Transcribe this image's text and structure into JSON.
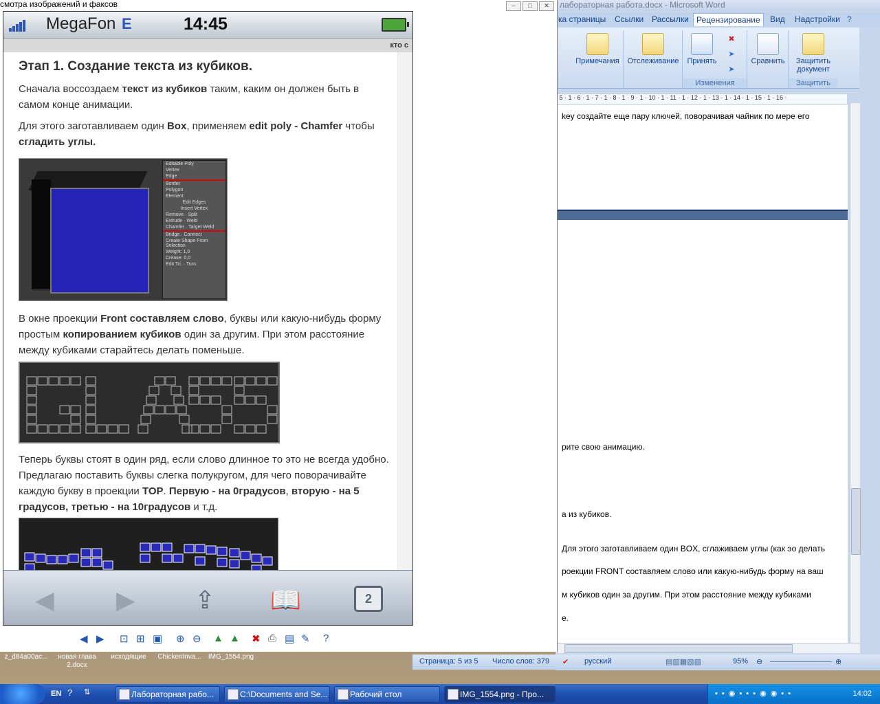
{
  "viewer": {
    "title": "смотра изображений и факсов",
    "phone": {
      "carrier": "MegaFon",
      "network": "E",
      "time": "14:45",
      "site_label": "кто с",
      "article": {
        "heading": "Этап 1. Создание текста из кубиков.",
        "p1_a": "Сначала воссоздаем ",
        "p1_b": "текст из кубиков",
        "p1_c": " таким, каким он должен быть в самом конце анимации.",
        "p2_a": "Для этого заготавливаем один ",
        "p2_b": "Box",
        "p2_c": ", применяем ",
        "p2_d": "edit poly - Chamfer",
        "p2_e": " чтобы ",
        "p2_f": "сгладить углы.",
        "p3_a": "В окне проекции ",
        "p3_b": "Front составляем слово",
        "p3_c": ", буквы или какую-нибудь форму простым ",
        "p3_d": "копированием кубиков",
        "p3_e": " один за другим. При этом расстояние между кубиками старайтесь делать поменьше.",
        "p4_a": "Теперь буквы стоят в один ряд, если слово длинное то это не всегда удобно. Предлагаю поставить буквы слегка полукругом, для чего поворачивайте каждую букву в проекции ",
        "p4_b": "TOP",
        "p4_c": ". ",
        "p4_d": "Первую - на 0градусов",
        "p4_e": ", ",
        "p4_f": "вторую - на 5 градусов, третью - на 10градусов",
        "p4_g": " и т.д."
      },
      "panel_items": [
        "Editable Poly",
        "Vertex",
        "Edge",
        "Border",
        "Polygon",
        "Element",
        "Edit Edges",
        "Insert Vertex",
        "Remove",
        "Split",
        "Extrude",
        "Weld",
        "Chamfer",
        "Target Weld",
        "Bridge",
        "Connect",
        "Create Shape From Selection",
        "Weight:",
        "Crease:",
        "Edit Tri.",
        "Turn"
      ],
      "panel_values": [
        "1,0",
        "0,0"
      ],
      "tabs_count": "2"
    }
  },
  "word": {
    "title": "лабораторная работа.docx - Microsoft Word",
    "tabs": [
      "ка страницы",
      "Ссылки",
      "Рассылки",
      "Рецензирование",
      "Вид",
      "Надстройки"
    ],
    "ribbon": {
      "buttons": [
        "Примечания",
        "Отслеживание",
        "Принять",
        "Сравнить",
        "Защитить документ"
      ],
      "groups": [
        "Изменения",
        "Защитить"
      ]
    },
    "ruler": "· 5 · 1 · 6 · 1 · 7 · 1 · 8 · 1 · 9 · 1 · 10 · 1 · 11 · 1 · 12 · 1 · 13 · 1 · 14 · 1 · 15 · 1 · 16 ·",
    "lines": {
      "l1": "key создайте еще пару ключей, поворачивая чайник по мере его",
      "l2": "рите свою анимацию.",
      "l3": "а из кубиков.",
      "l4": "Для этого заготавливаем  один BOX, сглаживаем углы (как эо делать",
      "l5": "роекции FRONT  составляем слово или какую-нибудь  форму на ваш",
      "l6": "м кубиков  один за другим.  При этом   расстояние между кубиками",
      "l7": "е."
    },
    "status": {
      "page": "Страница: 5 из 5",
      "words": "Число слов: 379",
      "lang": "русский",
      "zoom": "95%"
    }
  },
  "desktop_labels": [
    "z_d84a00ac...",
    "новая глава 2.docx",
    "исходящие",
    "ChickenInva...",
    "IMG_1554.png"
  ],
  "taskbar": {
    "lang": "EN",
    "items": [
      "Лабораторная рабо...",
      "C:\\Documents and Se...",
      "Рабочий стол",
      "IMG_1554.png - Про..."
    ],
    "time": "14:02"
  }
}
